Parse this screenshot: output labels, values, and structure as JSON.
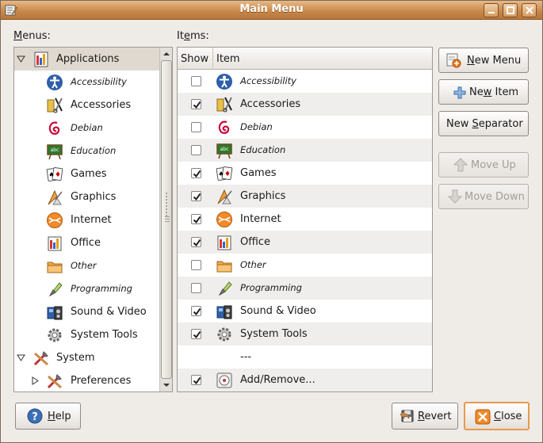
{
  "window": {
    "title": "Main Menu",
    "accent": "#c98a4e"
  },
  "labels": {
    "menus_prefix": "M",
    "menus_rest": "enus:",
    "items_prefix": "It",
    "items_u": "e",
    "items_rest": "ms:"
  },
  "menus": [
    {
      "label": "Applications",
      "icon": "applications-icon",
      "level": 0,
      "expander": "expanded",
      "italic": false,
      "selected": true
    },
    {
      "label": "Accessibility",
      "icon": "accessibility-icon",
      "level": 1,
      "italic": true
    },
    {
      "label": "Accessories",
      "icon": "accessories-icon",
      "level": 1,
      "italic": false
    },
    {
      "label": "Debian",
      "icon": "debian-icon",
      "level": 1,
      "italic": true
    },
    {
      "label": "Education",
      "icon": "education-icon",
      "level": 1,
      "italic": true
    },
    {
      "label": "Games",
      "icon": "games-icon",
      "level": 1,
      "italic": false
    },
    {
      "label": "Graphics",
      "icon": "graphics-icon",
      "level": 1,
      "italic": false
    },
    {
      "label": "Internet",
      "icon": "internet-icon",
      "level": 1,
      "italic": false
    },
    {
      "label": "Office",
      "icon": "office-icon",
      "level": 1,
      "italic": false
    },
    {
      "label": "Other",
      "icon": "folder-icon",
      "level": 1,
      "italic": true
    },
    {
      "label": "Programming",
      "icon": "programming-icon",
      "level": 1,
      "italic": true
    },
    {
      "label": "Sound & Video",
      "icon": "sound-video-icon",
      "level": 1,
      "italic": false
    },
    {
      "label": "System Tools",
      "icon": "system-tools-icon",
      "level": 1,
      "italic": false
    },
    {
      "label": "System",
      "icon": "system-icon",
      "level": 0,
      "expander": "expanded",
      "italic": false
    },
    {
      "label": "Preferences",
      "icon": "preferences-icon",
      "level": 1,
      "expander": "collapsed",
      "italic": false
    }
  ],
  "items_table": {
    "columns": {
      "show": "Show",
      "item": "Item"
    },
    "rows": [
      {
        "label": "Accessibility",
        "icon": "accessibility-icon",
        "checked": false,
        "italic": true
      },
      {
        "label": "Accessories",
        "icon": "accessories-icon",
        "checked": true,
        "italic": false
      },
      {
        "label": "Debian",
        "icon": "debian-icon",
        "checked": false,
        "italic": true
      },
      {
        "label": "Education",
        "icon": "education-icon",
        "checked": false,
        "italic": true
      },
      {
        "label": "Games",
        "icon": "games-icon",
        "checked": true,
        "italic": false
      },
      {
        "label": "Graphics",
        "icon": "graphics-icon",
        "checked": true,
        "italic": false
      },
      {
        "label": "Internet",
        "icon": "internet-icon",
        "checked": true,
        "italic": false
      },
      {
        "label": "Office",
        "icon": "office-icon",
        "checked": true,
        "italic": false
      },
      {
        "label": "Other",
        "icon": "folder-icon",
        "checked": false,
        "italic": true
      },
      {
        "label": "Programming",
        "icon": "programming-icon",
        "checked": false,
        "italic": true
      },
      {
        "label": "Sound & Video",
        "icon": "sound-video-icon",
        "checked": true,
        "italic": false
      },
      {
        "label": "System Tools",
        "icon": "system-tools-icon",
        "checked": true,
        "italic": false
      },
      {
        "label": "---",
        "icon": "",
        "checked": null,
        "italic": false
      },
      {
        "label": "Add/Remove...",
        "icon": "add-remove-icon",
        "checked": true,
        "italic": false
      }
    ]
  },
  "buttons": {
    "new_menu": {
      "pre": "",
      "u": "N",
      "post": "ew Menu"
    },
    "new_item": {
      "pre": "Ne",
      "u": "w",
      "post": " Item"
    },
    "new_separator": {
      "pre": "New ",
      "u": "S",
      "post": "eparator"
    },
    "move_up": {
      "label": "Move Up"
    },
    "move_down": {
      "label": "Move Down"
    },
    "help": {
      "pre": "",
      "u": "H",
      "post": "elp"
    },
    "revert": {
      "pre": "",
      "u": "R",
      "post": "evert"
    },
    "close": {
      "pre": "",
      "u": "C",
      "post": "lose"
    }
  }
}
